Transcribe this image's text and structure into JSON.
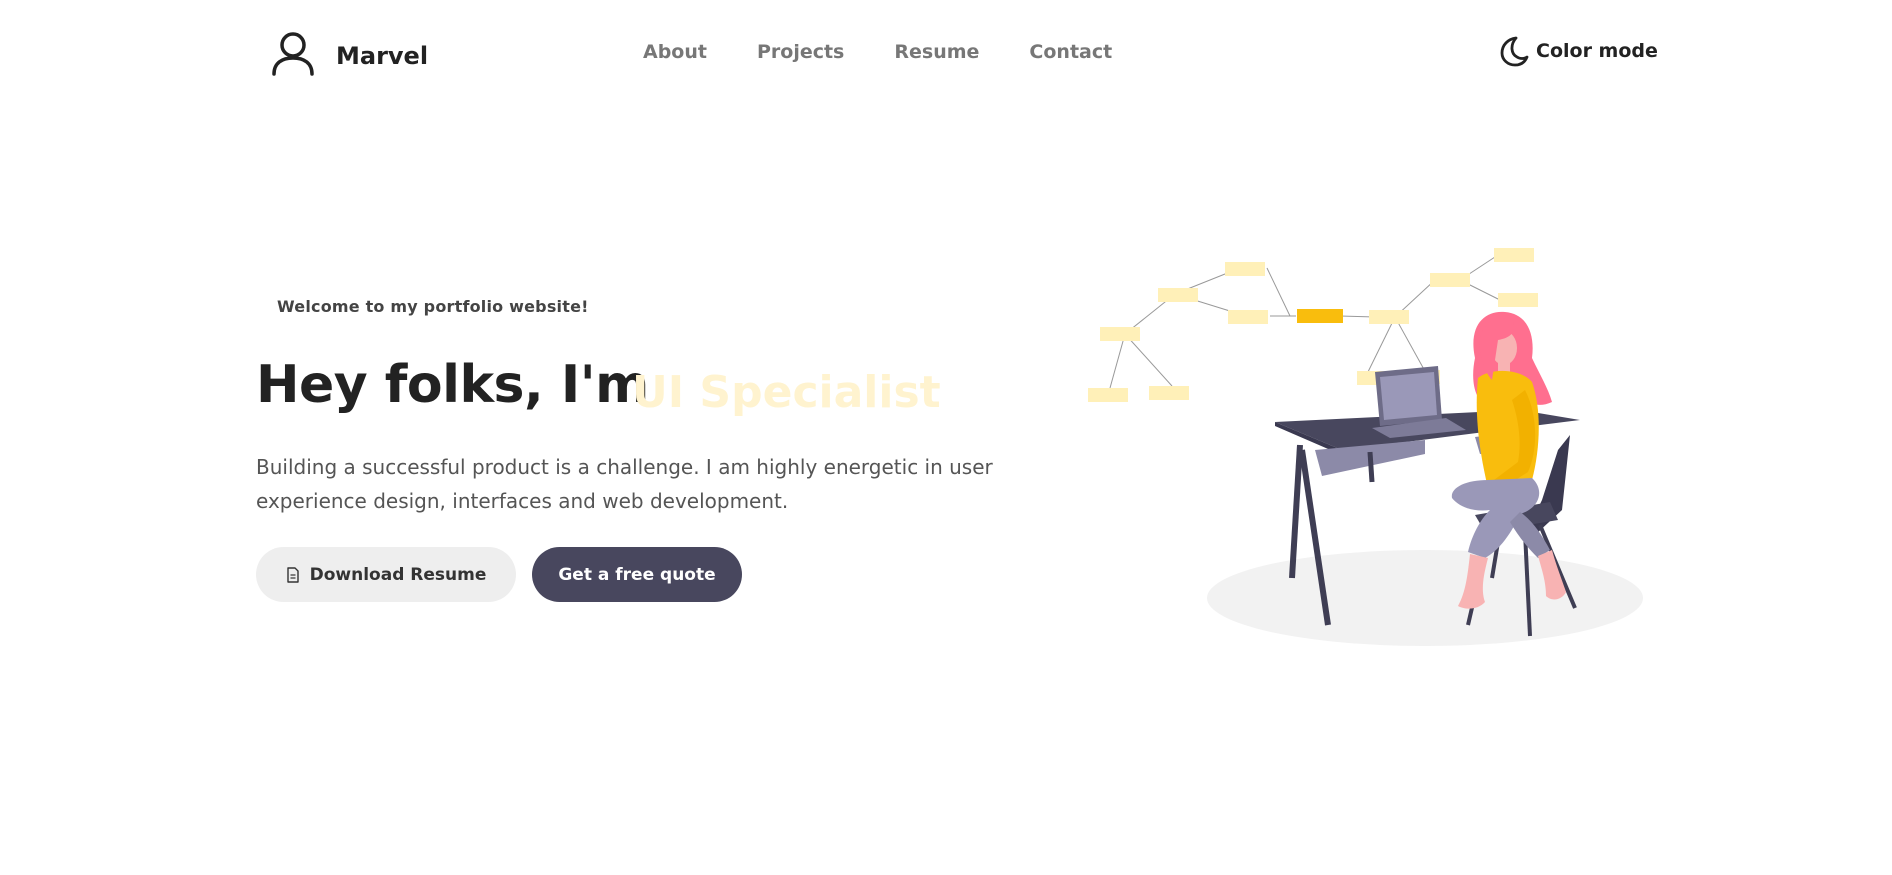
{
  "header": {
    "brand_name": "Marvel",
    "brand_icon": "user-icon",
    "nav": [
      {
        "label": "About"
      },
      {
        "label": "Projects"
      },
      {
        "label": "Resume"
      },
      {
        "label": "Contact"
      }
    ],
    "color_mode_label": "Color mode",
    "color_mode_icon": "moon-icon"
  },
  "hero": {
    "kicker": "Welcome to my portfolio website!",
    "headline": "Hey folks, I'm",
    "role": "UI Specialist",
    "lead": "Building a successful product is a challenge. I am highly energetic in user experience design, interfaces and web development.",
    "buttons": {
      "download_label": "Download Resume",
      "download_icon": "document-icon",
      "quote_label": "Get a free quote"
    }
  },
  "colors": {
    "primary": "#48475e",
    "accent": "#f9bd0d",
    "role_text": "#fff3cf",
    "button_light": "#eeeeee"
  }
}
